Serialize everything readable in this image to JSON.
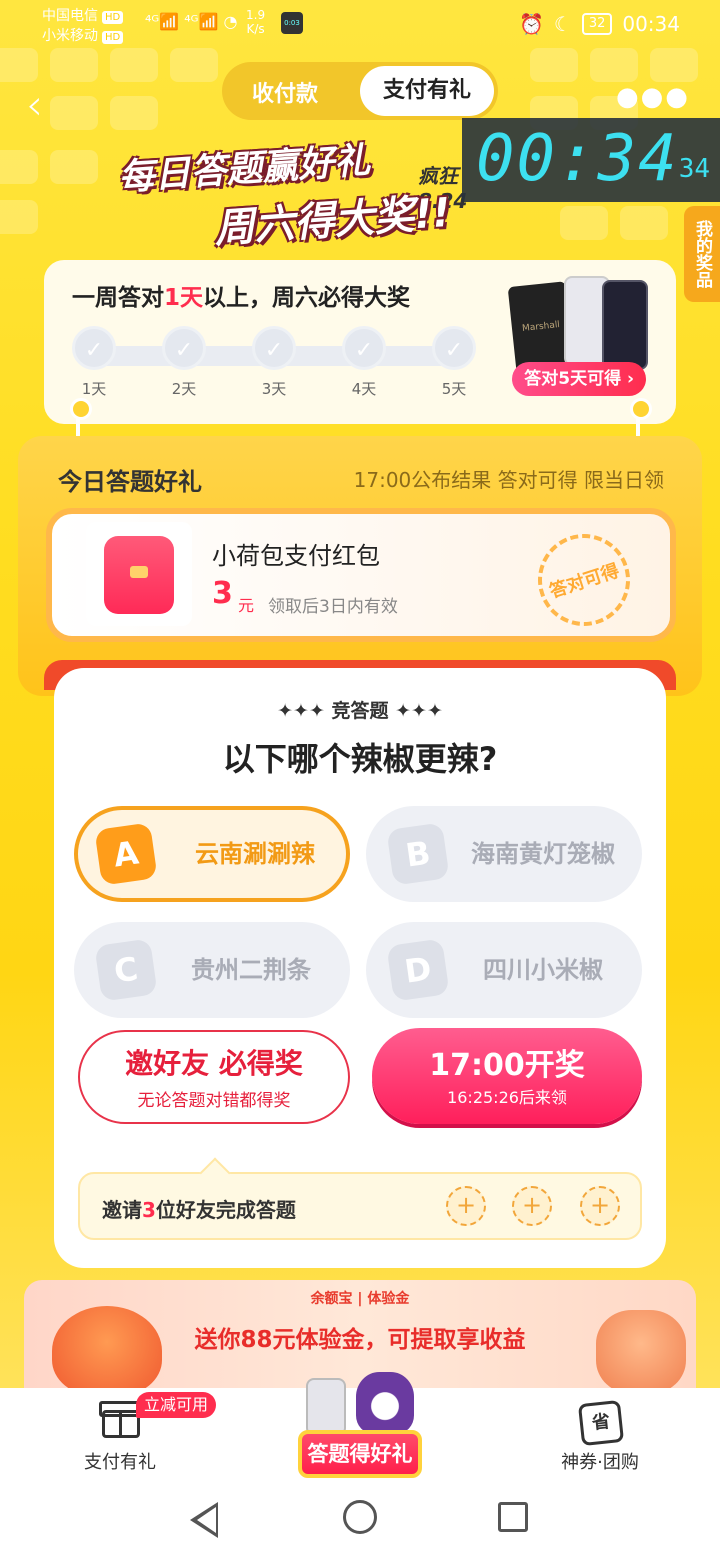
{
  "status_bar": {
    "carrier1": "中国电信",
    "carrier2": "小米移动",
    "hd": "HD",
    "signal": "⁴ᴳ📶 ⁴ᴳ📶 ◔",
    "speed_value": "1.9",
    "speed_unit": "K/s",
    "battery": "32",
    "time": "00:34"
  },
  "header": {
    "back_icon": "chevron-left-icon",
    "tab_inactive": "收付款",
    "tab_active": "支付有礼",
    "more_icon": "more-icon"
  },
  "banner": {
    "line1": "每日答题赢好礼",
    "line2": "周六得大奖!!",
    "date": "8.24",
    "date_label": "疯狂"
  },
  "clock_overlay": {
    "big": "00:34",
    "small": "34"
  },
  "side_tab": {
    "label": "我的奖品"
  },
  "week_card": {
    "title_prefix": "一周答对",
    "title_highlight": "1天",
    "title_suffix": "以上，周六必得大奖",
    "days": [
      "1天",
      "2天",
      "3天",
      "4天",
      "5天"
    ],
    "check": "✓",
    "speaker_label": "Marshall",
    "prize_badge": "答对5天可得 ›"
  },
  "today_gift": {
    "title": "今日答题好礼",
    "note": "17:00公布结果 答对可得 限当日领",
    "gift_name": "小荷包支付红包",
    "amount": "3",
    "unit": "元",
    "validity": "领取后3日内有效",
    "stamp": "答对可得"
  },
  "quiz": {
    "tag": "✦✦✦ 竞答题 ✦✦✦",
    "question": "以下哪个辣椒更辣?",
    "options": [
      {
        "letter": "A",
        "text": "云南涮涮辣"
      },
      {
        "letter": "B",
        "text": "海南黄灯笼椒"
      },
      {
        "letter": "C",
        "text": "贵州二荆条"
      },
      {
        "letter": "D",
        "text": "四川小米椒"
      }
    ],
    "selected": "A",
    "invite_title": "邀好友 必得奖",
    "invite_sub": "无论答题对错都得奖",
    "open_title": "17:00开奖",
    "open_sub": "16:25:26后来领",
    "invite_row_prefix": "邀请",
    "invite_row_count": "3",
    "invite_row_suffix": "位好友完成答题",
    "plus": "+"
  },
  "promo": {
    "brand": "余额宝 | 体验金",
    "main": "送你88元体验金，可提取享收益"
  },
  "tab_bar": {
    "tab1_label": "支付有礼",
    "tab1_badge": "立减可用",
    "center_label": "答题得好礼",
    "tab3_label": "神券·团购",
    "tab3_icon_text": "省"
  },
  "colors": {
    "accent_red": "#ff2d4e",
    "accent_yellow": "#ffdd20",
    "accent_orange": "#f6a21e"
  }
}
